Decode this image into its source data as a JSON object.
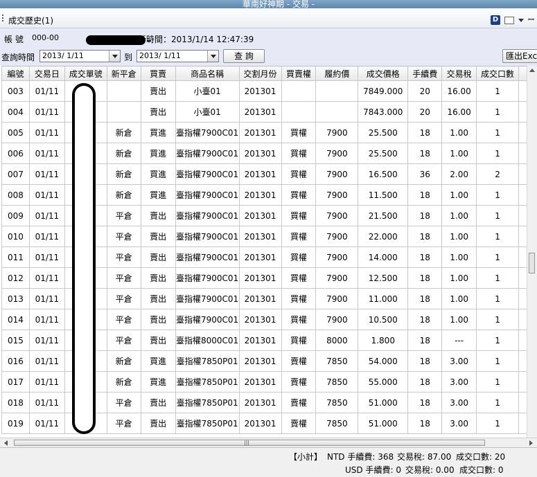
{
  "window": {
    "title": "華南好神期 - 交易 -"
  },
  "panel": {
    "title": "成交歷史(1)"
  },
  "toolbar": {
    "account_label": "帳 號",
    "account_value": "000-00",
    "updated_label": "更新時間：2013/1/14 12:47:39",
    "query_label": "查詢時間",
    "date_from": "2013/ 1/11",
    "to_label": "到",
    "date_to": "2013/ 1/11",
    "query_button": "查 詢",
    "export_button": "匯出Excel"
  },
  "table": {
    "columns": [
      "編號",
      "交易日",
      "成交單號",
      "新平倉",
      "買賣",
      "商品名稱",
      "交割月份",
      "買賣權",
      "履約價",
      "成交價格",
      "手續費",
      "交易稅",
      "成交口數"
    ],
    "rows": [
      [
        "003",
        "01/11",
        "",
        "",
        "賣出",
        "小臺01",
        "201301",
        "",
        "",
        "7849.000",
        "20",
        "16.00",
        "1"
      ],
      [
        "004",
        "01/11",
        "",
        "",
        "賣出",
        "小臺01",
        "201301",
        "",
        "",
        "7843.000",
        "20",
        "16.00",
        "1"
      ],
      [
        "005",
        "01/11",
        "",
        "新倉",
        "買進",
        "臺指權7900C01",
        "201301",
        "買權",
        "7900",
        "25.500",
        "18",
        "1.00",
        "1"
      ],
      [
        "006",
        "01/11",
        "",
        "新倉",
        "買進",
        "臺指權7900C01",
        "201301",
        "買權",
        "7900",
        "25.500",
        "18",
        "1.00",
        "1"
      ],
      [
        "007",
        "01/11",
        "",
        "新倉",
        "買進",
        "臺指權7900C01",
        "201301",
        "買權",
        "7900",
        "16.500",
        "36",
        "2.00",
        "2"
      ],
      [
        "008",
        "01/11",
        "",
        "新倉",
        "買進",
        "臺指權7900C01",
        "201301",
        "買權",
        "7900",
        "11.500",
        "18",
        "1.00",
        "1"
      ],
      [
        "009",
        "01/11",
        "",
        "平倉",
        "賣出",
        "臺指權7900C01",
        "201301",
        "買權",
        "7900",
        "21.500",
        "18",
        "1.00",
        "1"
      ],
      [
        "010",
        "01/11",
        "",
        "平倉",
        "賣出",
        "臺指權7900C01",
        "201301",
        "買權",
        "7900",
        "22.000",
        "18",
        "1.00",
        "1"
      ],
      [
        "011",
        "01/11",
        "",
        "平倉",
        "賣出",
        "臺指權7900C01",
        "201301",
        "買權",
        "7900",
        "14.000",
        "18",
        "1.00",
        "1"
      ],
      [
        "012",
        "01/11",
        "",
        "平倉",
        "賣出",
        "臺指權7900C01",
        "201301",
        "買權",
        "7900",
        "12.500",
        "18",
        "1.00",
        "1"
      ],
      [
        "013",
        "01/11",
        "",
        "平倉",
        "賣出",
        "臺指權7900C01",
        "201301",
        "買權",
        "7900",
        "11.000",
        "18",
        "1.00",
        "1"
      ],
      [
        "014",
        "01/11",
        "",
        "平倉",
        "賣出",
        "臺指權7900C01",
        "201301",
        "買權",
        "7900",
        "10.500",
        "18",
        "1.00",
        "1"
      ],
      [
        "015",
        "01/11",
        "",
        "平倉",
        "賣出",
        "臺指權8000C01",
        "201301",
        "買權",
        "8000",
        "1.800",
        "18",
        "---",
        "1"
      ],
      [
        "016",
        "01/11",
        "",
        "新倉",
        "買進",
        "臺指權7850P01",
        "201301",
        "賣權",
        "7850",
        "54.000",
        "18",
        "3.00",
        "1"
      ],
      [
        "017",
        "01/11",
        "",
        "新倉",
        "買進",
        "臺指權7850P01",
        "201301",
        "賣權",
        "7850",
        "55.000",
        "18",
        "3.00",
        "1"
      ],
      [
        "018",
        "01/11",
        "",
        "平倉",
        "賣出",
        "臺指權7850P01",
        "201301",
        "賣權",
        "7850",
        "51.000",
        "18",
        "3.00",
        "1"
      ],
      [
        "019",
        "01/11",
        "",
        "平倉",
        "賣出",
        "臺指權7850P01",
        "201301",
        "賣權",
        "7850",
        "51.000",
        "18",
        "3.00",
        "1"
      ]
    ]
  },
  "summary": {
    "subtotal_label": "【小計】",
    "ntd_fee": "NTD 手續費: 368",
    "ntd_tax": "交易稅: 87.00",
    "ntd_qty": "成交口數: 20",
    "usd_fee": "USD 手續費: 0",
    "usd_tax": "交易稅: 0.00",
    "usd_qty": "成交口數: 0"
  }
}
